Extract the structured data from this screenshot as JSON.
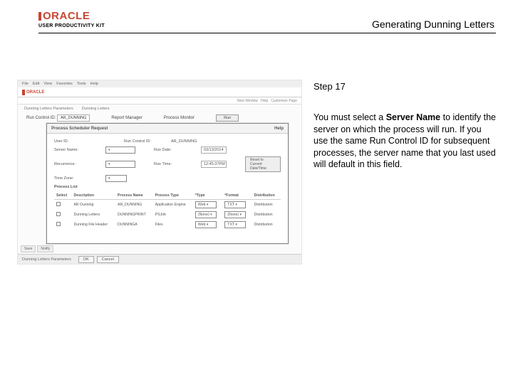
{
  "header": {
    "brand": "ORACLE",
    "subbrand": "USER PRODUCTIVITY KIT",
    "title": "Generating Dunning Letters"
  },
  "side": {
    "step": "Step 17",
    "text_before": "You must select a ",
    "bold": "Server Name",
    "text_after": " to identify the server on which the process will run. If you use the same Run Control ID for subsequent processes, the server name that you last used will default in this field."
  },
  "shot": {
    "menubar": [
      "File",
      "Edit",
      "View",
      "Favorites",
      "Tools",
      "Help"
    ],
    "crumbs": [
      "Dunning Letters Parameters",
      "Dunning Letters"
    ],
    "subhdr": [
      "New Window",
      "Help",
      "Customize Page"
    ],
    "param": {
      "runctl_lbl": "Run Control ID:",
      "runctl_val": "AR_DUNNING",
      "reportmgr": "Report Manager",
      "procmon": "Process Monitor",
      "runbtn": "Run"
    },
    "modal": {
      "title": "Process Scheduler Request",
      "help": "Help",
      "user_lbl": "User ID:",
      "run_lbl": "Run Control ID:",
      "run_val": "AR_DUNNING",
      "server_lbl": "Server Name:",
      "rundate_lbl": "Run Date:",
      "rundate_val": "03/13/2014",
      "recur_lbl": "Recurrence:",
      "runtime_lbl": "Run Time:",
      "runtime_val": "12:45:37PM",
      "reset": "Reset to Current Date/Time",
      "tz_lbl": "Time Zone:",
      "plh": "Process List",
      "cols": [
        "Select",
        "Description",
        "Process Name",
        "Process Type",
        "*Type",
        "*Format",
        "Distribution"
      ],
      "rows": [
        {
          "sel": "",
          "desc": "AR Dunning",
          "pname": "AR_DUNNING",
          "ptype": "Application Engine",
          "type": "Web",
          "fmt": "TXT",
          "dist": "Distribution"
        },
        {
          "sel": "",
          "desc": "Dunning Letters",
          "pname": "DUNNINGPRINT",
          "ptype": "PSJob",
          "type": "(None)",
          "fmt": "(None)",
          "dist": "Distribution"
        },
        {
          "sel": "",
          "desc": "Dunning File Header",
          "pname": "DUNNINGA",
          "ptype": "Files",
          "type": "Web",
          "fmt": "TXT",
          "dist": "Distribution"
        }
      ]
    },
    "footer": {
      "ok": "OK",
      "cancel": "Cancel"
    },
    "tabs": [
      "Save",
      "Notify"
    ],
    "footlabel": "Dunning Letters Parameters"
  }
}
